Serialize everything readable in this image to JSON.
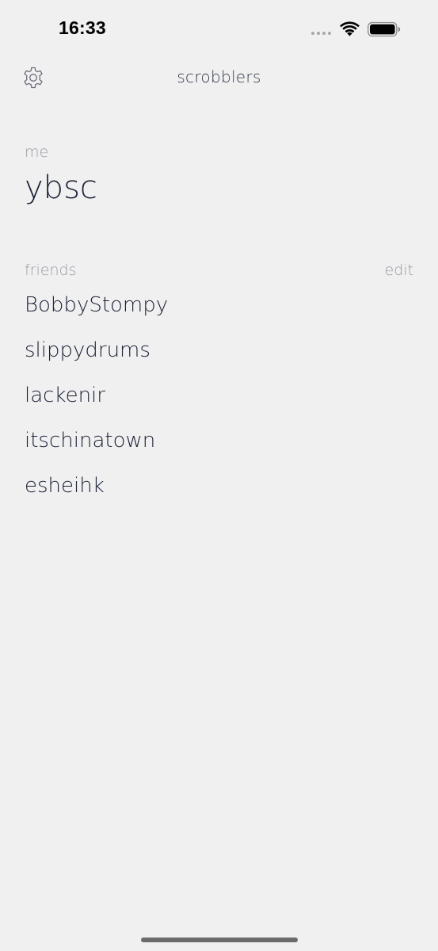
{
  "status_bar": {
    "time": "16:33"
  },
  "nav": {
    "title": "scrobblers",
    "settings_icon": "gear-icon"
  },
  "me": {
    "label": "me",
    "username": "ybsc"
  },
  "friends": {
    "label": "friends",
    "edit_label": "edit",
    "items": [
      {
        "name": "BobbyStompy"
      },
      {
        "name": "slippydrums"
      },
      {
        "name": "lackenir"
      },
      {
        "name": "itschinatown"
      },
      {
        "name": "esheihk"
      }
    ]
  },
  "colors": {
    "background": "#f0f0f0",
    "text_primary": "#1d2238",
    "text_secondary": "#9a9ca6"
  }
}
